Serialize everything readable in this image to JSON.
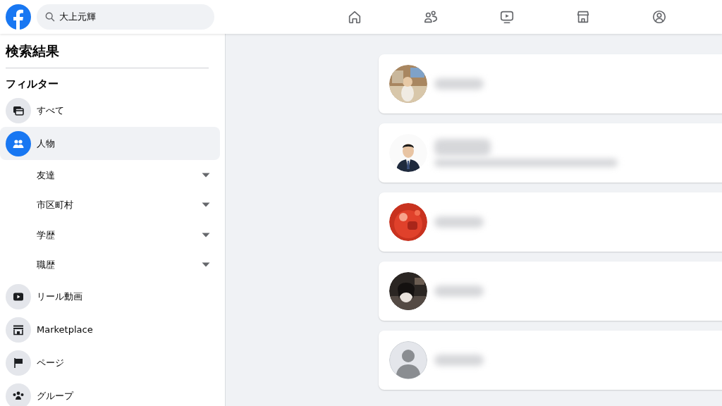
{
  "search": {
    "value": "大上元輝"
  },
  "nav": [
    {
      "selected": false
    },
    {
      "selected": false
    },
    {
      "selected": false
    },
    {
      "selected": false
    },
    {
      "selected": false
    }
  ],
  "sidebar": {
    "title": "検索結果",
    "filter_heading": "フィルター",
    "items": [
      {
        "kind": "category",
        "label": "すべて",
        "selected": false
      },
      {
        "kind": "category",
        "label": "人物",
        "selected": true
      },
      {
        "kind": "subfilter",
        "label": "友達"
      },
      {
        "kind": "subfilter",
        "label": "市区町村"
      },
      {
        "kind": "subfilter",
        "label": "学歴"
      },
      {
        "kind": "subfilter",
        "label": "職歴"
      },
      {
        "kind": "category",
        "label": "リール動画",
        "selected": false
      },
      {
        "kind": "category",
        "label": "Marketplace",
        "selected": false
      },
      {
        "kind": "category",
        "label": "ページ",
        "selected": false
      },
      {
        "kind": "category",
        "label": "グループ",
        "selected": false
      }
    ]
  },
  "results": [
    {
      "kind": "picture",
      "detail_line": false
    },
    {
      "kind": "picture",
      "detail_line": true
    },
    {
      "kind": "picture",
      "detail_line": false
    },
    {
      "kind": "picture",
      "detail_line": false
    },
    {
      "kind": "default-avatar",
      "detail_line": false
    }
  ]
}
